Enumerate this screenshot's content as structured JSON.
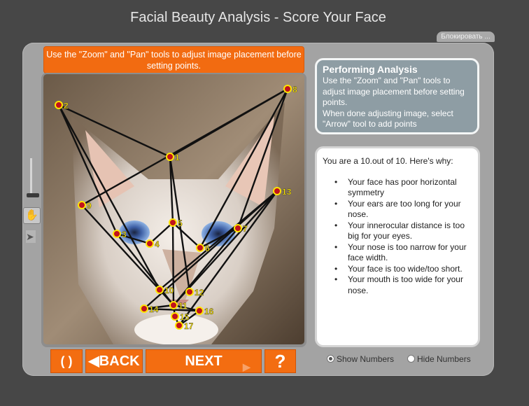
{
  "window": {
    "title": "Facial Beauty Analysis - Score Your Face",
    "block_button": "Блокировать ..."
  },
  "notice": {
    "text": "Use the \"Zoom\" and \"Pan\" tools to adjust image placement before setting points."
  },
  "tools": {
    "zoom": "zoom-slider",
    "pan": "hand-icon",
    "select": "arrow-icon"
  },
  "info": {
    "title": "Performing Analysis",
    "line1": "Use the \"Zoom\" and \"Pan\" tools to adjust image placement before setting points.",
    "line2": "When done adjusting image, select \"Arrow\" tool to add points"
  },
  "result": {
    "summary": "You are a 10.out of 10.  Here's why:",
    "reasons": [
      "Your face has poor horizontal symmetry",
      "Your ears are too long for your nose.",
      "Your innerocular distance is too big for your eyes.",
      "Your nose is too narrow for your face width.",
      "Your face is too wide/too short.",
      "Your mouth is too wide for your nose."
    ]
  },
  "buttons": {
    "refresh": "( )",
    "back": "◀BACK",
    "next": "NEXT",
    "help": "?"
  },
  "options": {
    "show_numbers": "Show Numbers",
    "hide_numbers": "Hide Numbers",
    "selected": "show_numbers"
  },
  "points": {
    "labels": [
      "1",
      "2",
      "3",
      "4",
      "5",
      "6",
      "7",
      "8",
      "9",
      "10",
      "11",
      "12",
      "13",
      "14",
      "15",
      "16",
      "17"
    ]
  },
  "colors": {
    "accent": "#f26b11",
    "panel": "#a3a3a3",
    "info_bg": "#8e9da4",
    "point": "#ffe600"
  }
}
